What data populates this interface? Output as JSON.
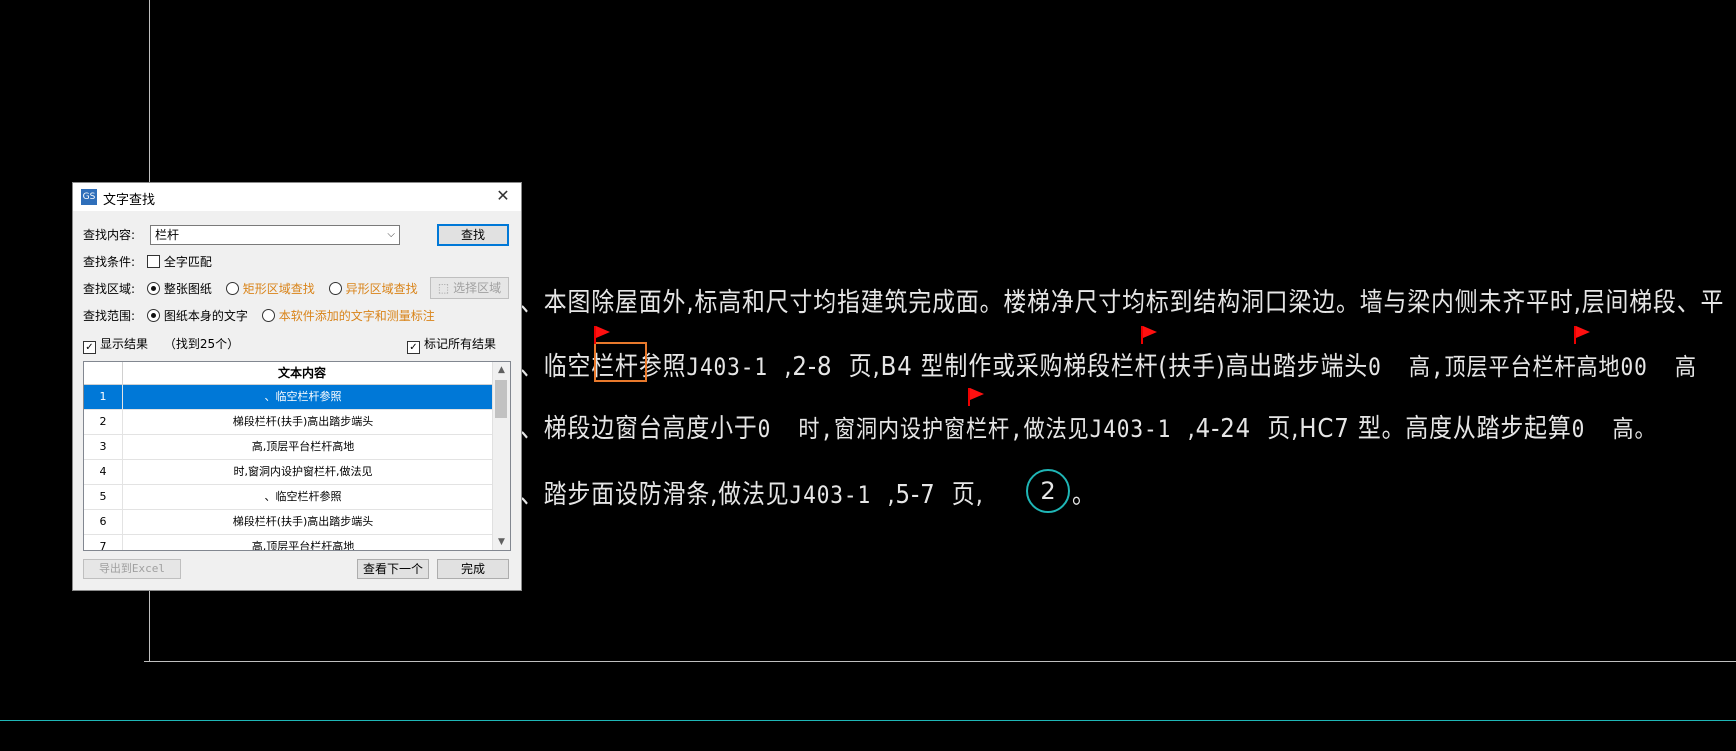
{
  "drawing": {
    "line1": "、本图除屋面外,标高和尺寸均指建筑完成面。楼梯净尺寸均标到结构洞口梁边。墙与梁内侧未齐平时,层间梯段、平",
    "line2_a": "、临空",
    "line2_hl": "栏杆",
    "line2_b": "参照",
    "line2_c": "J403-1",
    "line2_d": "  ,2-8  页,B4 型制作或采购梯段栏杆(扶手)高出踏步端头",
    "line2_e": "0  高,顶层平台栏杆高地",
    "line2_f": "00  高",
    "line3_a": "、梯段边窗台高度小于",
    "line3_b": "0  时,窗洞内设护窗栏杆,做法见",
    "line3_c": "J403-1",
    "line3_d": "  ,4-24  页,HC7 型。高度从踏步起算",
    "line3_e": "0  高。",
    "line4_a": "、踏步面设防滑条,做法见",
    "line4_b": "J403-1",
    "line4_c": "  ,5-7  页,",
    "line4_circle": "2",
    "line4_end": "。"
  },
  "dialog": {
    "title": "文字查找",
    "app_icon": "GS",
    "close": "✕",
    "search_label": "查找内容:",
    "search_value": "栏杆",
    "find_button": "查找",
    "condition_label": "查找条件:",
    "whole_word": "全字匹配",
    "area_label": "查找区域:",
    "area_options": [
      "整张图纸",
      "矩形区域查找",
      "异形区域查找"
    ],
    "select_area_button": "选择区域",
    "scope_label": "查找范围:",
    "scope_options": [
      "图纸本身的文字",
      "本软件添加的文字和测量标注"
    ],
    "show_results": "显示结果",
    "found_count": "（找到25个）",
    "mark_all": "标记所有结果",
    "table_header": "文本内容",
    "rows": [
      {
        "idx": "1",
        "text": "、临空栏杆参照"
      },
      {
        "idx": "2",
        "text": "梯段栏杆(扶手)高出踏步端头"
      },
      {
        "idx": "3",
        "text": "高,顶层平台栏杆高地"
      },
      {
        "idx": "4",
        "text": "时,窗洞内设护窗栏杆,做法见"
      },
      {
        "idx": "5",
        "text": "、临空栏杆参照"
      },
      {
        "idx": "6",
        "text": "梯段栏杆(扶手)高出踏步端头"
      },
      {
        "idx": "7",
        "text": "高,顶层平台栏杆高地"
      }
    ],
    "export_button": "导出到Excel",
    "next_button": "查看下一个",
    "done_button": "完成"
  },
  "colors": {
    "highlight_box": "#e8792c",
    "flag": "#ff1010",
    "cyan": "#1fb6b6",
    "selection": "#0078d7"
  }
}
